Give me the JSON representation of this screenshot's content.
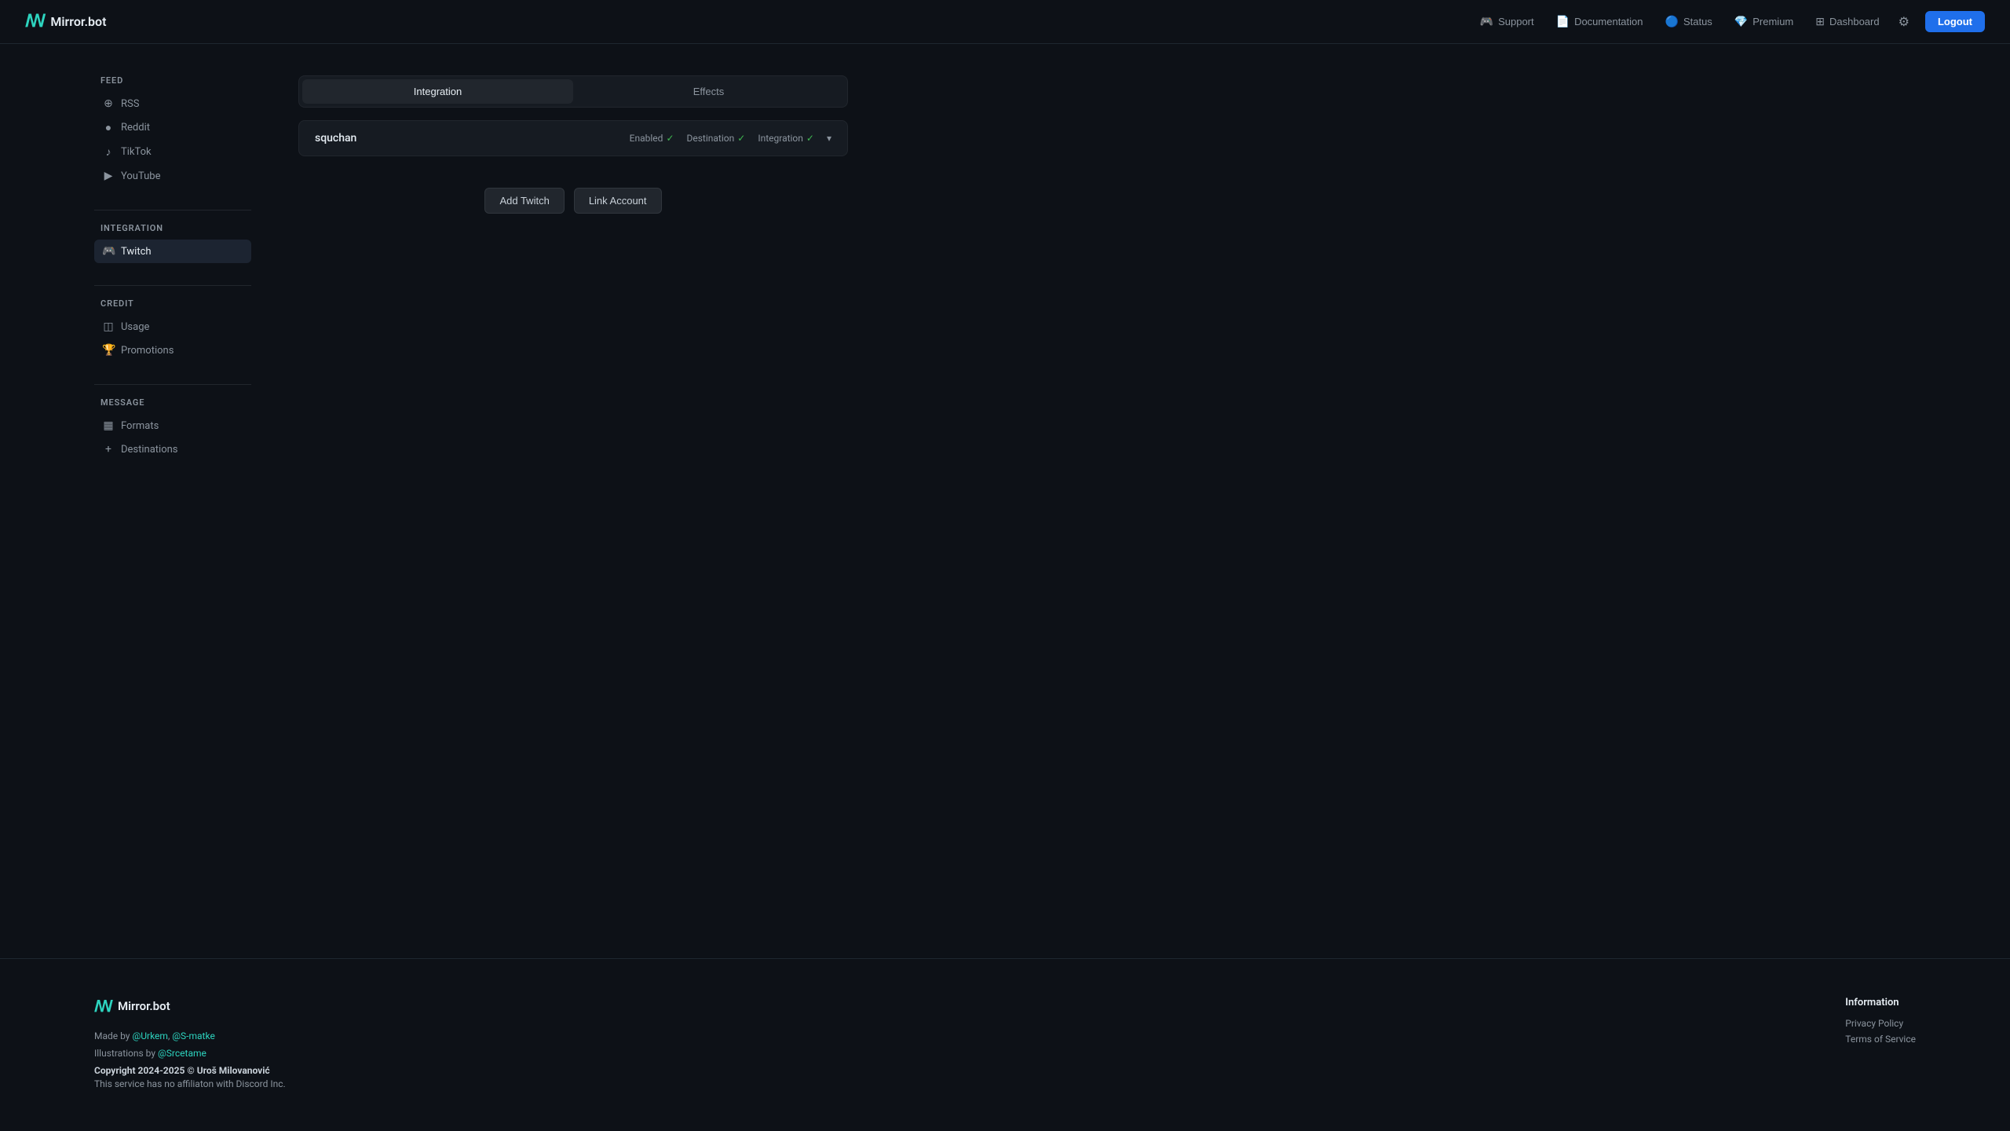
{
  "header": {
    "logo_icon": "ꟿ",
    "logo_text": "Mirror.bot",
    "nav": [
      {
        "id": "support",
        "label": "Support",
        "icon": "🎮"
      },
      {
        "id": "documentation",
        "label": "Documentation",
        "icon": "📄"
      },
      {
        "id": "status",
        "label": "Status",
        "icon": "🔵"
      },
      {
        "id": "premium",
        "label": "Premium",
        "icon": "💎"
      },
      {
        "id": "dashboard",
        "label": "Dashboard",
        "icon": "⊞"
      }
    ],
    "settings_icon": "⚙",
    "logout_label": "Logout"
  },
  "sidebar": {
    "sections": [
      {
        "id": "feed",
        "title": "Feed",
        "items": [
          {
            "id": "rss",
            "label": "RSS",
            "icon": "⊕"
          },
          {
            "id": "reddit",
            "label": "Reddit",
            "icon": "●"
          },
          {
            "id": "tiktok",
            "label": "TikTok",
            "icon": "♪"
          },
          {
            "id": "youtube",
            "label": "YouTube",
            "icon": "▶"
          }
        ]
      },
      {
        "id": "integration",
        "title": "Integration",
        "items": [
          {
            "id": "twitch",
            "label": "Twitch",
            "icon": "🎮",
            "active": true
          }
        ]
      },
      {
        "id": "credit",
        "title": "Credit",
        "items": [
          {
            "id": "usage",
            "label": "Usage",
            "icon": "◫"
          },
          {
            "id": "promotions",
            "label": "Promotions",
            "icon": "🏆"
          }
        ]
      },
      {
        "id": "message",
        "title": "Message",
        "items": [
          {
            "id": "formats",
            "label": "Formats",
            "icon": "▦"
          },
          {
            "id": "destinations",
            "label": "Destinations",
            "icon": "+"
          }
        ]
      }
    ]
  },
  "content": {
    "tabs": [
      {
        "id": "integration",
        "label": "Integration",
        "active": true
      },
      {
        "id": "effects",
        "label": "Effects",
        "active": false
      }
    ],
    "integration_item": {
      "name": "squchan",
      "enabled_label": "Enabled",
      "enabled_check": "✓",
      "destination_label": "Destination",
      "destination_check": "✓",
      "integration_label": "Integration",
      "integration_check": "✓"
    },
    "actions": {
      "add_button": "Add Twitch",
      "link_button": "Link Account"
    }
  },
  "footer": {
    "logo_icon": "ꟿ",
    "logo_text": "Mirror.bot",
    "made_by_prefix": "Made by ",
    "made_by_authors": "@Urkem, @S-matke",
    "illustrations_prefix": "Illustrations by ",
    "illustrations_author": "@Srcetame",
    "copyright": "Copyright 2024-2025 © Uroš Milovanović",
    "disclaimer": "This service has no affiliaton with Discord Inc.",
    "info_section": {
      "title": "Information",
      "links": [
        {
          "id": "privacy",
          "label": "Privacy Policy"
        },
        {
          "id": "tos",
          "label": "Terms of Service"
        }
      ]
    }
  }
}
